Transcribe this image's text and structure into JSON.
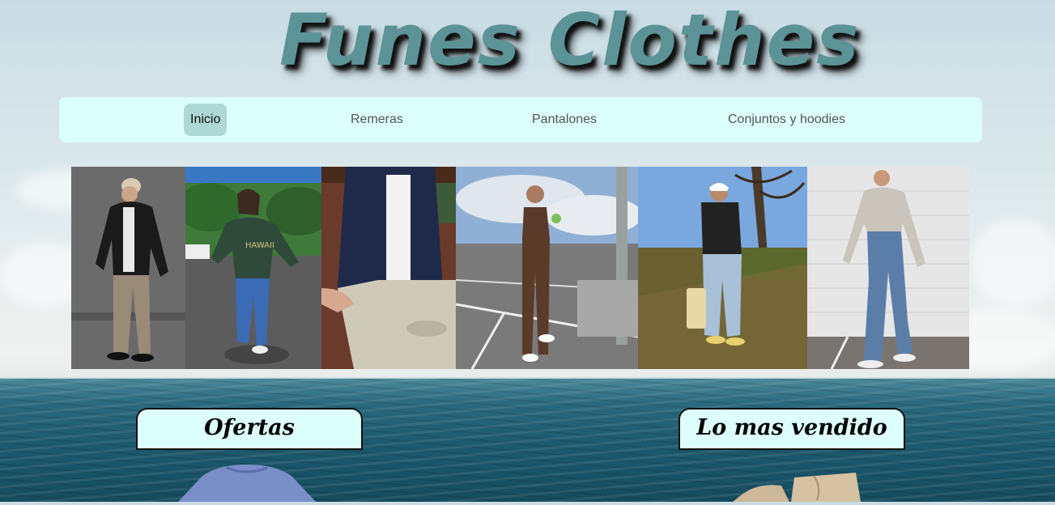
{
  "brand": {
    "logo_text": "Funes Clothes"
  },
  "nav": {
    "items": [
      {
        "label": "Inicio",
        "active": true
      },
      {
        "label": "Remeras",
        "active": false
      },
      {
        "label": "Pantalones",
        "active": false
      },
      {
        "label": "Conjuntos y hoodies",
        "active": false
      }
    ]
  },
  "sections": {
    "offers_label": "Ofertas",
    "best_sellers_label": "Lo mas vendido"
  },
  "colors": {
    "logo": "#5b9397",
    "nav_background": "#ddfffb",
    "nav_active": "#aed8d4",
    "label_background": "#ddfffb"
  }
}
